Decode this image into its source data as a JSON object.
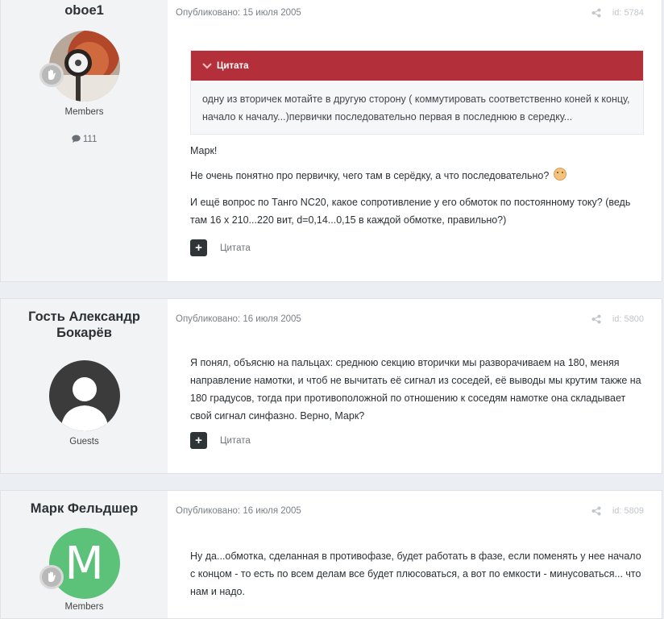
{
  "posts": [
    {
      "author": "oboe1",
      "group": "Members",
      "post_count": "111",
      "date": "Опубликовано: 15 июля 2005",
      "id": "id: 5784",
      "quote": {
        "label": "Цитата",
        "text": "одну из вторичек мотайте в другую сторону ( коммутировать соответственно коней к концу, начало к началу...)первички последовательно первая в последнюю в середку..."
      },
      "paragraphs": [
        "Марк!",
        "Не очень понятно про первичку, чего там в серёдку, а что последовательно?",
        "И ещё вопрос по Танго NC20, какое сопротивление у его обмоток по постоянному току? (ведь там 16 х 210...220 вит, d=0,14...0,15 в каждой обмотке, правильно?)"
      ],
      "action_label": "Цитата"
    },
    {
      "author": "Гость Александр Бокарёв",
      "group": "Guests",
      "date": "Опубликовано: 16 июля 2005",
      "id": "id: 5800",
      "paragraphs": [
        "Я понял, объясню на пальцах: среднюю секцию вторички мы разворачиваем на 180, меняя направление намотки, и чтоб не вычитать её сигнал из соседей, её выводы мы крутим также на 180 градусов, тогда при противоположной по отношению к соседям намотке она складывает свой сигнал синфазно. Верно, Марк?"
      ],
      "action_label": "Цитата"
    },
    {
      "author": "Марк Фельдшер",
      "group": "Members",
      "avatar_letter": "M",
      "date": "Опубликовано: 16 июля 2005",
      "id": "id: 5809",
      "paragraphs": [
        "Ну да...обмотка, сделанная в противофазе, будет работать в фазе, если поменять у нее начало с концом - то есть по всем делам все будет плюсоваться, а вот по емкости - минусоваться... что нам и надо."
      ]
    }
  ],
  "colors": {
    "quote_header": "#b3303a",
    "avatar_green": "#5cc27a",
    "avatar_guest": "#3a3a3a"
  },
  "icons": [
    "chevron-down-icon",
    "share-icon",
    "comment-icon",
    "plus-icon",
    "rank-hand-icon",
    "confused-emoji-icon"
  ]
}
